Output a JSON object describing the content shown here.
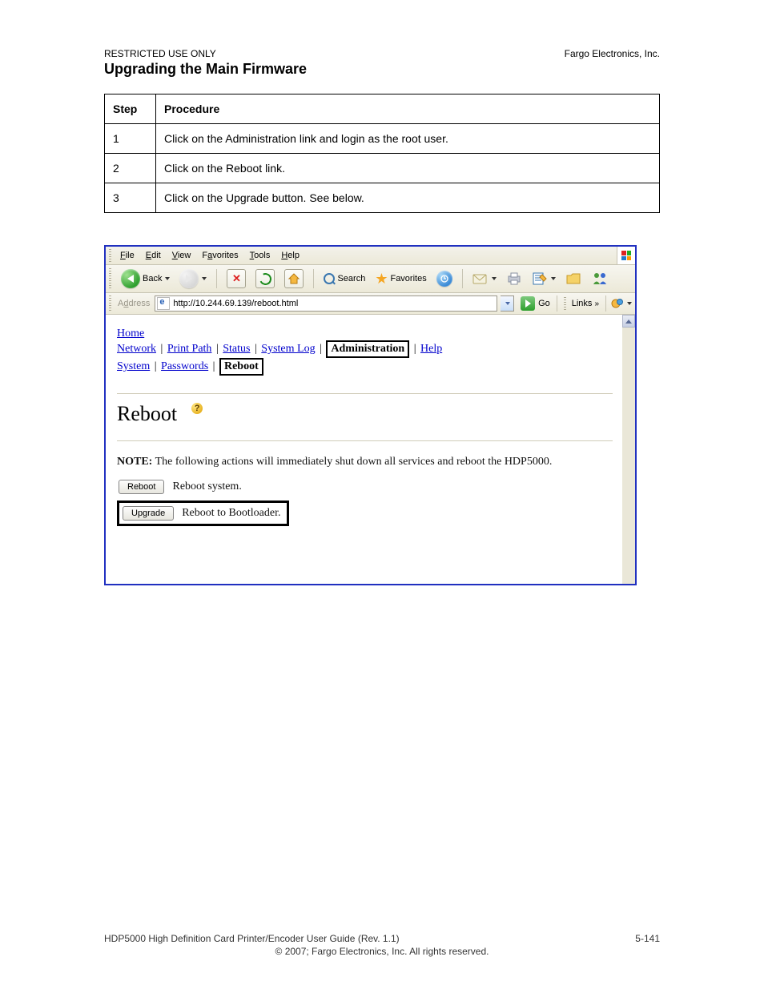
{
  "document": {
    "pre_header": "RESTRICTED USE ONLY",
    "company": "Fargo Electronics, Inc.",
    "heading": "Upgrading the Main Firmware",
    "steps_table": {
      "header_step": "Step",
      "header_proc": "Procedure",
      "rows": [
        {
          "num": "1",
          "text": "Click on the Administration link and login as the root user."
        },
        {
          "num": "2",
          "text": "Click on the Reboot link."
        },
        {
          "num": "3",
          "text": "Click on the Upgrade button.  See below."
        }
      ]
    },
    "footer_left": "HDP5000 High Definition Card Printer/Encoder User Guide (Rev. 1.1)",
    "footer_right": "5-141",
    "copyright": "© 2007; Fargo Electronics, Inc. All rights reserved."
  },
  "browser": {
    "menu": {
      "file": "File",
      "edit": "Edit",
      "view": "View",
      "favorites": "Favorites",
      "tools": "Tools",
      "help": "Help"
    },
    "toolbar": {
      "back": "Back",
      "search": "Search",
      "favorites": "Favorites"
    },
    "address": {
      "label": "Address",
      "url": "http://10.244.69.139/reboot.html",
      "go": "Go",
      "links": "Links"
    }
  },
  "page_content": {
    "nav": {
      "home": "Home",
      "network": "Network",
      "print_path": "Print Path",
      "status": "Status",
      "system_log": "System Log",
      "administration": "Administration",
      "help": "Help",
      "system": "System",
      "passwords": "Passwords",
      "reboot": "Reboot"
    },
    "title": "Reboot",
    "note_label": "NOTE:",
    "note_text": " The following actions will immediately shut down all services and reboot the HDP5000.",
    "reboot_btn": "Reboot",
    "reboot_desc": "Reboot system.",
    "upgrade_btn": "Upgrade",
    "upgrade_desc": "Reboot to Bootloader."
  }
}
